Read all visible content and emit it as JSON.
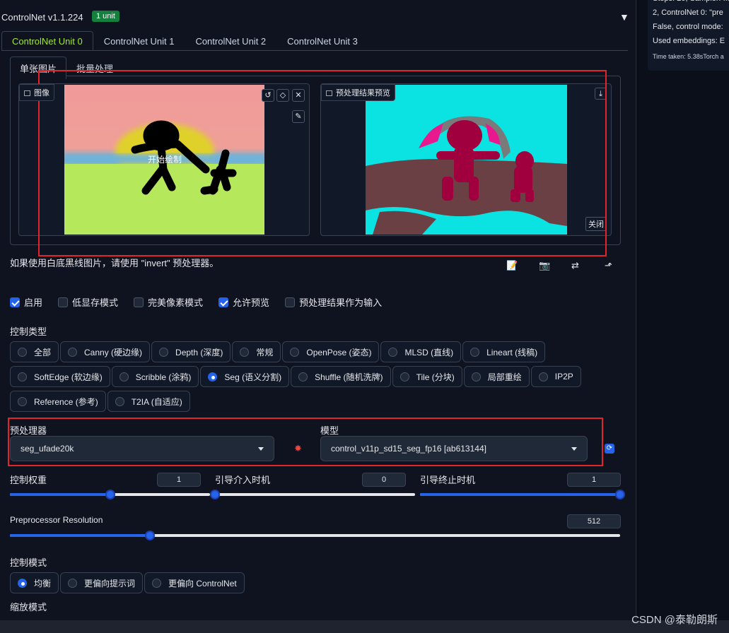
{
  "header": {
    "title": "ControlNet v1.1.224",
    "badge": "1 unit",
    "collapse_icon": "triangle-down-icon"
  },
  "unit_tabs": [
    {
      "label": "ControlNet Unit 0",
      "active": true
    },
    {
      "label": "ControlNet Unit 1",
      "active": false
    },
    {
      "label": "ControlNet Unit 2",
      "active": false
    },
    {
      "label": "ControlNet Unit 3",
      "active": false
    }
  ],
  "sub_tabs": [
    {
      "label": "单张图片",
      "active": true
    },
    {
      "label": "批量处理",
      "active": false
    }
  ],
  "image_panel": {
    "label": "图像",
    "overlay_text": "开始绘制",
    "tools": [
      "undo-icon",
      "eraser-icon",
      "close-icon",
      "brush-icon"
    ]
  },
  "preview_panel": {
    "label": "预处理结果预览",
    "close_label": "关闭",
    "tools": [
      "download-icon"
    ]
  },
  "hint": "如果使用白底黑线图片，请使用 \"invert\" 预处理器。",
  "action_icons": [
    "notepad-icon",
    "camera-icon",
    "swap-icon",
    "upload-icon"
  ],
  "checkboxes": [
    {
      "label": "启用",
      "checked": true
    },
    {
      "label": "低显存模式",
      "checked": false
    },
    {
      "label": "完美像素模式",
      "checked": false
    },
    {
      "label": "允许预览",
      "checked": true
    },
    {
      "label": "预处理结果作为输入",
      "checked": false
    }
  ],
  "control_type": {
    "label": "控制类型",
    "rows": [
      [
        {
          "label": "全部",
          "selected": false
        },
        {
          "label": "Canny (硬边缘)",
          "selected": false
        },
        {
          "label": "Depth (深度)",
          "selected": false
        },
        {
          "label": "常规",
          "selected": false
        },
        {
          "label": "OpenPose (姿态)",
          "selected": false
        },
        {
          "label": "MLSD (直线)",
          "selected": false
        },
        {
          "label": "Lineart (线稿)",
          "selected": false
        }
      ],
      [
        {
          "label": "SoftEdge (软边缘)",
          "selected": false
        },
        {
          "label": "Scribble (涂鸦)",
          "selected": false
        },
        {
          "label": "Seg (语义分割)",
          "selected": true
        },
        {
          "label": "Shuffle (随机洗牌)",
          "selected": false
        },
        {
          "label": "Tile (分块)",
          "selected": false
        },
        {
          "label": "局部重绘",
          "selected": false
        },
        {
          "label": "IP2P",
          "selected": false
        }
      ],
      [
        {
          "label": "Reference (参考)",
          "selected": false
        },
        {
          "label": "T2IA (自适应)",
          "selected": false
        }
      ]
    ]
  },
  "preprocessor": {
    "label": "预处理器",
    "value": "seg_ufade20k"
  },
  "model": {
    "label": "模型",
    "value": "control_v11p_sd15_seg_fp16 [ab613144]"
  },
  "run_icon": "explosion-icon",
  "refresh_icon": "refresh-icon",
  "sliders": {
    "weight": {
      "label": "控制权重",
      "value": "1",
      "fraction": 0.5
    },
    "start": {
      "label": "引导介入时机",
      "value": "0",
      "fraction": 0.0
    },
    "end": {
      "label": "引导终止时机",
      "value": "1",
      "fraction": 1.0
    },
    "resolution": {
      "label": "Preprocessor Resolution",
      "value": "512",
      "fraction": 0.23
    }
  },
  "control_mode": {
    "label": "控制模式",
    "options": [
      {
        "label": "均衡",
        "selected": true
      },
      {
        "label": "更偏向提示词",
        "selected": false
      },
      {
        "label": "更偏向 ControlNet",
        "selected": false
      }
    ]
  },
  "resize_mode": {
    "label": "缩放模式"
  },
  "log": {
    "lines": [
      "Steps: 20, Sampler: ...",
      "2, ControlNet 0: \"pre",
      "False, control mode:",
      "Used embeddings: E"
    ],
    "time": "Time taken: 5.38sTorch a"
  },
  "watermark": "CSDN @泰勒朗斯",
  "colors": {
    "accent": "#2563eb",
    "active_tab": "#a3e635",
    "highlight": "#e0262b",
    "badge": "#15803d"
  }
}
